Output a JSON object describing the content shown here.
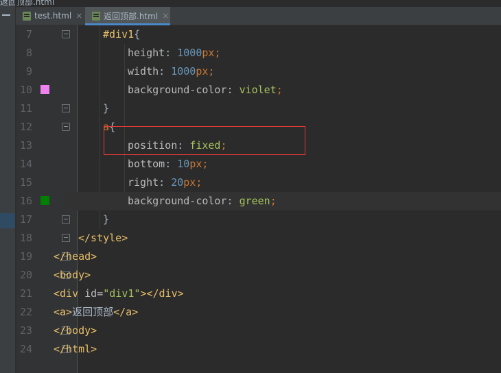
{
  "breadcrumb": "返回顶部.html",
  "tabs": [
    {
      "label": "test.html",
      "close": "×",
      "active": false
    },
    {
      "label": "返回顶部.html",
      "close": "×",
      "active": true
    }
  ],
  "colors": {
    "swatch_line_10": "#ee82ee",
    "swatch_line_16": "#008000",
    "annotation_box": "#e03a3a"
  },
  "lines": [
    {
      "n": "7",
      "tokens": [
        {
          "t": "#div1",
          "c": "t-sel"
        },
        {
          "t": "{",
          "c": "t-text"
        }
      ]
    },
    {
      "n": "8",
      "tokens": [
        {
          "t": "height",
          "c": "t-prop"
        },
        {
          "t": ": ",
          "c": "t-text"
        },
        {
          "t": "1000",
          "c": "t-num"
        },
        {
          "t": "px",
          "c": "t-unit"
        },
        {
          "t": ";",
          "c": "t-punct"
        }
      ]
    },
    {
      "n": "9",
      "tokens": [
        {
          "t": "width",
          "c": "t-prop"
        },
        {
          "t": ": ",
          "c": "t-text"
        },
        {
          "t": "1000",
          "c": "t-num"
        },
        {
          "t": "px",
          "c": "t-unit"
        },
        {
          "t": ";",
          "c": "t-punct"
        }
      ]
    },
    {
      "n": "10",
      "tokens": [
        {
          "t": "background-color",
          "c": "t-prop"
        },
        {
          "t": ": ",
          "c": "t-text"
        },
        {
          "t": "violet",
          "c": "t-val"
        },
        {
          "t": ";",
          "c": "t-punct"
        }
      ]
    },
    {
      "n": "11",
      "tokens": [
        {
          "t": "}",
          "c": "t-text"
        }
      ]
    },
    {
      "n": "12",
      "tokens": [
        {
          "t": "a",
          "c": "t-unit"
        },
        {
          "t": "{",
          "c": "t-text"
        }
      ]
    },
    {
      "n": "13",
      "tokens": [
        {
          "t": "position",
          "c": "t-prop"
        },
        {
          "t": ": ",
          "c": "t-text"
        },
        {
          "t": "fixed",
          "c": "t-val"
        },
        {
          "t": ";",
          "c": "t-punct"
        }
      ]
    },
    {
      "n": "14",
      "tokens": [
        {
          "t": "bottom",
          "c": "t-prop"
        },
        {
          "t": ": ",
          "c": "t-text"
        },
        {
          "t": "10",
          "c": "t-num"
        },
        {
          "t": "px",
          "c": "t-unit"
        },
        {
          "t": ";",
          "c": "t-punct"
        }
      ]
    },
    {
      "n": "15",
      "tokens": [
        {
          "t": "right",
          "c": "t-prop"
        },
        {
          "t": ": ",
          "c": "t-text"
        },
        {
          "t": "20",
          "c": "t-num"
        },
        {
          "t": "px",
          "c": "t-unit"
        },
        {
          "t": ";",
          "c": "t-punct"
        }
      ]
    },
    {
      "n": "16",
      "tokens": [
        {
          "t": "background-color",
          "c": "t-prop"
        },
        {
          "t": ": ",
          "c": "t-text"
        },
        {
          "t": "green",
          "c": "t-val"
        },
        {
          "t": ";",
          "c": "t-punct"
        }
      ]
    },
    {
      "n": "17",
      "tokens": [
        {
          "t": "}",
          "c": "t-text"
        }
      ]
    },
    {
      "n": "18",
      "tokens": [
        {
          "t": "</style>",
          "c": "t-tag"
        }
      ]
    },
    {
      "n": "19",
      "tokens": [
        {
          "t": "</head>",
          "c": "t-tag"
        }
      ]
    },
    {
      "n": "20",
      "tokens": [
        {
          "t": "<body>",
          "c": "t-tag"
        }
      ]
    },
    {
      "n": "21",
      "tokens": [
        {
          "t": "<div ",
          "c": "t-tag"
        },
        {
          "t": "id=",
          "c": "t-attr"
        },
        {
          "t": "\"div1\"",
          "c": "t-str"
        },
        {
          "t": "></div>",
          "c": "t-tag"
        }
      ]
    },
    {
      "n": "22",
      "tokens": [
        {
          "t": "<a>",
          "c": "t-tag"
        },
        {
          "t": "返回顶部",
          "c": "t-text"
        },
        {
          "t": "</a>",
          "c": "t-tag"
        }
      ]
    },
    {
      "n": "23",
      "tokens": [
        {
          "t": "</body>",
          "c": "t-tag"
        }
      ]
    },
    {
      "n": "24",
      "tokens": [
        {
          "t": "</html>",
          "c": "t-tag"
        }
      ]
    }
  ]
}
